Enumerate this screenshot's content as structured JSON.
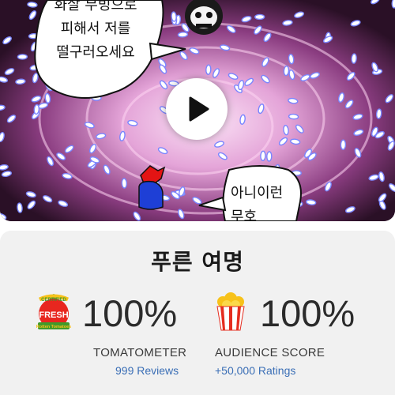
{
  "video": {
    "bubble_left_lines": [
      "화살 무빙으로",
      "피해서 저를",
      "떨구러오세요"
    ],
    "bubble_right_lines": [
      "아니이런",
      "무호"
    ]
  },
  "movie": {
    "title": "푸른 여명"
  },
  "scores": {
    "tomatometer": {
      "icon": "fresh-tomato-icon",
      "badge_top": "CERTIFIED",
      "badge_main": "FRESH",
      "badge_bottom": "Rotten Tomatoes",
      "value": "100%",
      "label": "TOMATOMETER",
      "link": "999 Reviews",
      "colors": {
        "tomato": "#e8271f",
        "leaf": "#3f9a2a",
        "ribbon": "#f7c21a"
      }
    },
    "audience": {
      "icon": "popcorn-bucket-icon",
      "value": "100%",
      "label": "AUDIENCE SCORE",
      "link": "+50,000 Ratings",
      "colors": {
        "bucket_stripe": "#e52d20",
        "popcorn": "#f7c21a"
      }
    }
  },
  "colors": {
    "link": "#3b6fb6",
    "card_bg": "#f1f1f1"
  }
}
